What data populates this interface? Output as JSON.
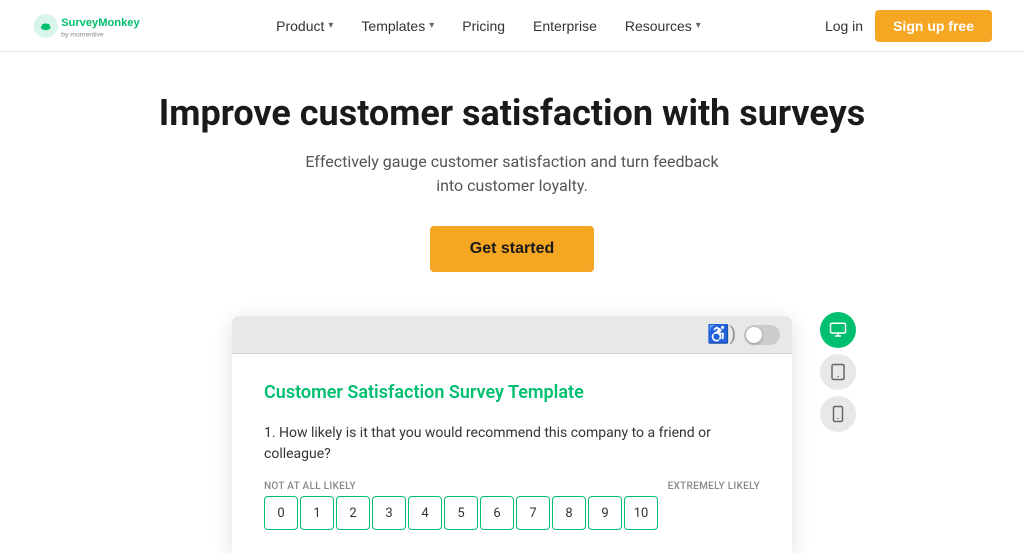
{
  "brand": {
    "name": "SurveyMonkey",
    "tagline": "by momentive"
  },
  "nav": {
    "links": [
      {
        "id": "product",
        "label": "Product",
        "has_dropdown": true
      },
      {
        "id": "templates",
        "label": "Templates",
        "has_dropdown": true
      },
      {
        "id": "pricing",
        "label": "Pricing",
        "has_dropdown": false
      },
      {
        "id": "enterprise",
        "label": "Enterprise",
        "has_dropdown": false
      },
      {
        "id": "resources",
        "label": "Resources",
        "has_dropdown": true
      }
    ],
    "login_label": "Log in",
    "signup_label": "Sign up free"
  },
  "hero": {
    "heading": "Improve customer satisfaction with surveys",
    "subheading": "Effectively gauge customer satisfaction and turn feedback into customer loyalty.",
    "cta_label": "Get started"
  },
  "survey_preview": {
    "title": "Customer Satisfaction Survey Template",
    "question": "1. How likely is it that you would recommend this company to a friend or colleague?",
    "scale_low_label": "NOT AT ALL LIKELY",
    "scale_high_label": "EXTREMELY LIKELY",
    "scale_numbers": [
      "0",
      "1",
      "2",
      "3",
      "4",
      "5",
      "6",
      "7",
      "8",
      "9",
      "10"
    ]
  },
  "device_icons": [
    {
      "id": "desktop",
      "active": true
    },
    {
      "id": "tablet",
      "active": false
    },
    {
      "id": "mobile",
      "active": false
    }
  ]
}
